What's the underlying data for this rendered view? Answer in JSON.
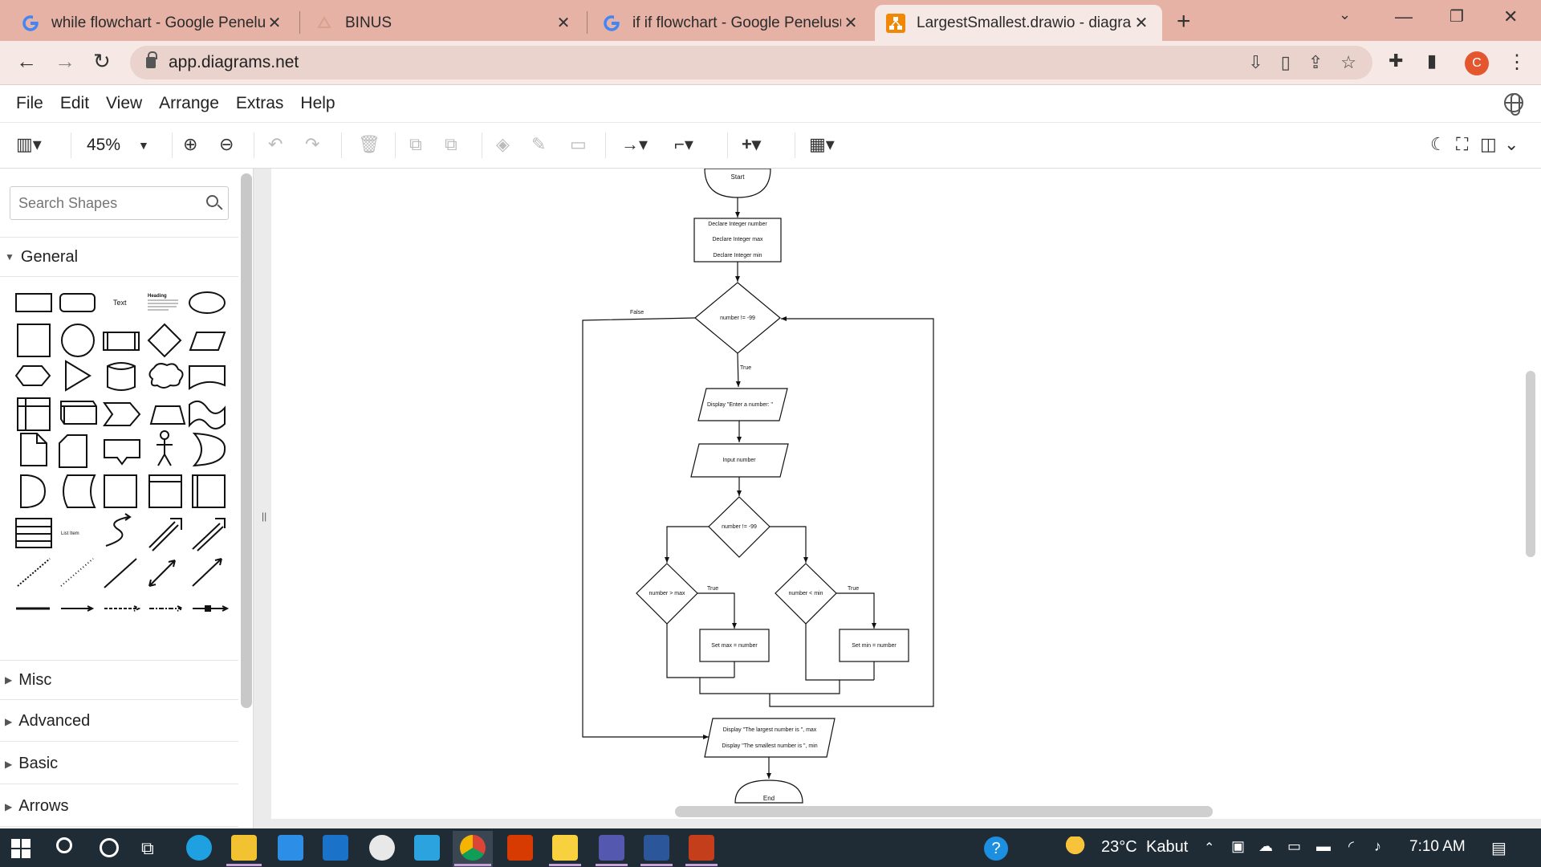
{
  "browser": {
    "tabs": [
      {
        "title": "while flowchart - Google Penelusuran",
        "icon": "google-icon"
      },
      {
        "title": "BINUS",
        "icon": "binus-icon"
      },
      {
        "title": "if if flowchart - Google Penelusuran",
        "icon": "google-icon"
      },
      {
        "title": "LargestSmallest.drawio - diagrams.net",
        "icon": "drawio-icon"
      }
    ],
    "url": "app.diagrams.net",
    "profile_initial": "C"
  },
  "menu": [
    "File",
    "Edit",
    "View",
    "Arrange",
    "Extras",
    "Help"
  ],
  "toolbar": {
    "zoom": "45%"
  },
  "sidebar": {
    "search_placeholder": "Search Shapes",
    "sections": [
      "General",
      "Misc",
      "Advanced",
      "Basic",
      "Arrows"
    ],
    "shape_text": "Text",
    "shape_heading": "Heading",
    "shape_list_item": "List Item"
  },
  "flowchart": {
    "start": "Start",
    "declare_1": "Declare Integer number",
    "declare_2": "Declare Integer max",
    "declare_3": "Declare Integer min",
    "loop_condition": "number != -99",
    "false_label": "False",
    "true_label": "True",
    "display_prompt": "Display \"Enter a number: \"",
    "input": "Input number",
    "inner_condition": "number != -99",
    "max_condition": "number > max",
    "min_condition": "number < min",
    "set_max": "Set max = number",
    "set_min": "Set min = number",
    "output_1": "Display \"The largest number is  \", max",
    "output_2": "Display \"The smallest number is \", min",
    "end": "End"
  },
  "taskbar": {
    "temperature": "23°C",
    "weather": "Kabut",
    "time": "7:10 AM"
  }
}
